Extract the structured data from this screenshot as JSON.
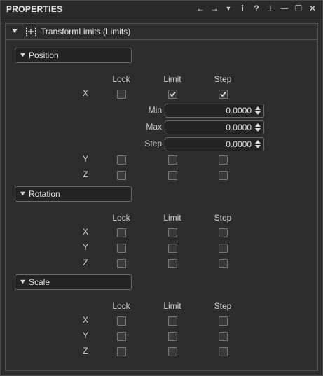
{
  "window": {
    "title": "PROPERTIES",
    "toolbar_icons": [
      "arrow-left-icon",
      "arrow-right-icon",
      "dropdown-icon",
      "info-icon",
      "help-icon",
      "pin-icon",
      "minimize-icon",
      "maximize-icon",
      "close-icon"
    ],
    "toolbar_glyphs": [
      "←",
      "→",
      "▼",
      "i",
      "?",
      "⊥",
      "—",
      "☐",
      "✕"
    ]
  },
  "component": {
    "label": "TransformLimits (Limits)"
  },
  "columns": {
    "lock": "Lock",
    "limit": "Limit",
    "step": "Step"
  },
  "rows": {
    "x": "X",
    "y": "Y",
    "z": "Z"
  },
  "position": {
    "title": "Position",
    "x": {
      "lock": false,
      "limit": true,
      "step": true
    },
    "y": {
      "lock": false,
      "limit": false,
      "step": false
    },
    "z": {
      "lock": false,
      "limit": false,
      "step": false
    },
    "fields": [
      {
        "label": "Min",
        "value": "0.0000"
      },
      {
        "label": "Max",
        "value": "0.0000"
      },
      {
        "label": "Step",
        "value": "0.0000"
      }
    ]
  },
  "rotation": {
    "title": "Rotation",
    "x": {
      "lock": false,
      "limit": false,
      "step": false
    },
    "y": {
      "lock": false,
      "limit": false,
      "step": false
    },
    "z": {
      "lock": false,
      "limit": false,
      "step": false
    }
  },
  "scale": {
    "title": "Scale",
    "x": {
      "lock": false,
      "limit": false,
      "step": false
    },
    "y": {
      "lock": false,
      "limit": false,
      "step": false
    },
    "z": {
      "lock": false,
      "limit": false,
      "step": false
    }
  }
}
